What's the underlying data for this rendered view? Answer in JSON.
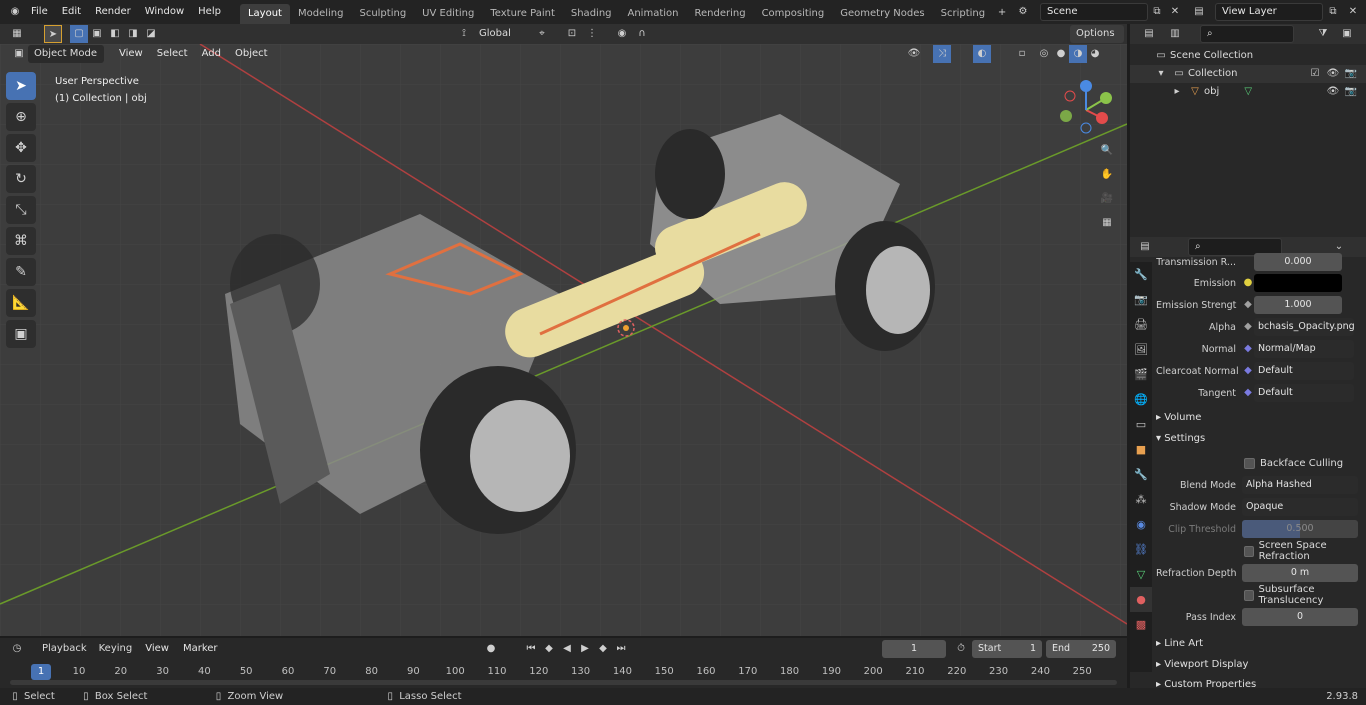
{
  "menu": {
    "file": "File",
    "edit": "Edit",
    "render": "Render",
    "window": "Window",
    "help": "Help"
  },
  "workspaces": [
    "Layout",
    "Modeling",
    "Sculpting",
    "UV Editing",
    "Texture Paint",
    "Shading",
    "Animation",
    "Rendering",
    "Compositing",
    "Geometry Nodes",
    "Scripting"
  ],
  "scene": "Scene",
  "view_layer": "View Layer",
  "header": {
    "orientation": "Global",
    "options": "Options",
    "mode": "Object Mode",
    "view": "View",
    "select": "Select",
    "add": "Add",
    "object": "Object"
  },
  "overlay": {
    "perspective": "User Perspective",
    "collection": "(1) Collection | obj"
  },
  "outliner": {
    "scene_collection": "Scene Collection",
    "collection": "Collection",
    "obj": "obj"
  },
  "props": {
    "transmission": "Transmission R...",
    "transmission_val": "0.000",
    "emission": "Emission",
    "emission_strength": "Emission Strengt",
    "emission_strength_val": "1.000",
    "alpha": "Alpha",
    "alpha_val": "bchasis_Opacity.png",
    "normal": "Normal",
    "normal_val": "Normal/Map",
    "clearcoat_normal": "Clearcoat Normal",
    "clearcoat_val": "Default",
    "tangent": "Tangent",
    "tangent_val": "Default",
    "volume": "Volume",
    "settings": "Settings",
    "backface": "Backface Culling",
    "blend_mode": "Blend Mode",
    "blend_mode_val": "Alpha Hashed",
    "shadow_mode": "Shadow Mode",
    "shadow_mode_val": "Opaque",
    "clip_threshold": "Clip Threshold",
    "clip_val": "0.500",
    "ssr": "Screen Space Refraction",
    "refraction_depth": "Refraction Depth",
    "refraction_val": "0 m",
    "subsurface": "Subsurface Translucency",
    "pass_index": "Pass Index",
    "pass_index_val": "0",
    "line_art": "Line Art",
    "viewport_display": "Viewport Display",
    "custom_props": "Custom Properties"
  },
  "timeline": {
    "playback": "Playback",
    "keying": "Keying",
    "view": "View",
    "marker": "Marker",
    "current": "1",
    "start_label": "Start",
    "start": "1",
    "end_label": "End",
    "end": "250",
    "ticks": [
      "1",
      "10",
      "20",
      "30",
      "40",
      "50",
      "60",
      "70",
      "80",
      "90",
      "100",
      "110",
      "120",
      "130",
      "140",
      "150",
      "160",
      "170",
      "180",
      "190",
      "200",
      "210",
      "220",
      "230",
      "240",
      "250"
    ]
  },
  "status": {
    "select": "Select",
    "box_select": "Box Select",
    "zoom_view": "Zoom View",
    "lasso": "Lasso Select",
    "version": "2.93.8"
  }
}
